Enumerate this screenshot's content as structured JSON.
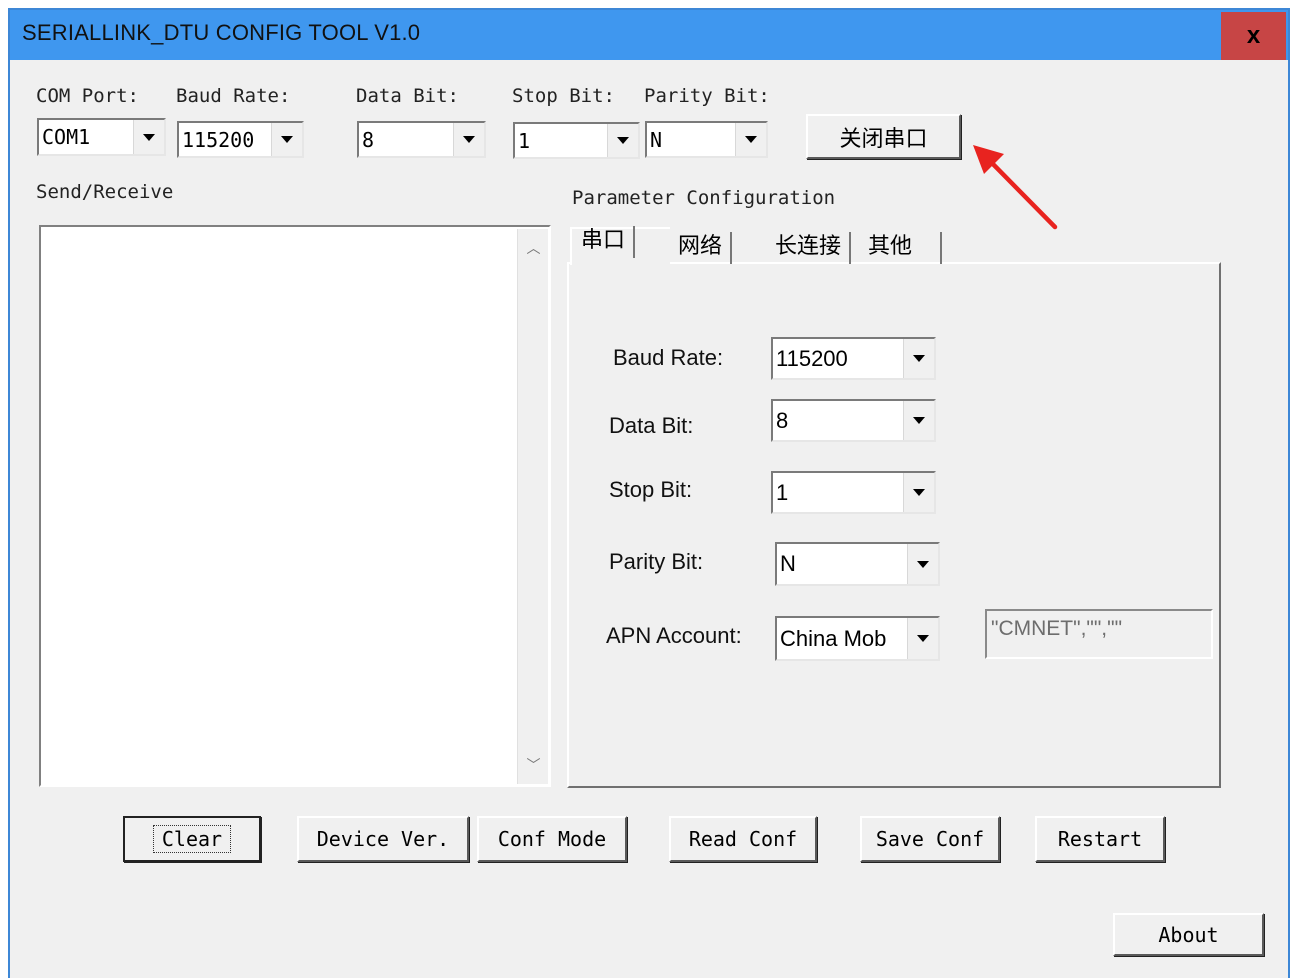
{
  "window": {
    "title": "SERIALLINK_DTU CONFIG TOOL V1.0",
    "close_label": "x"
  },
  "top": {
    "com_port": {
      "label": "COM Port:",
      "value": "COM1"
    },
    "baud_rate": {
      "label": "Baud Rate:",
      "value": "115200"
    },
    "data_bit": {
      "label": "Data Bit:",
      "value": "8"
    },
    "stop_bit": {
      "label": "Stop Bit:",
      "value": "1"
    },
    "parity_bit": {
      "label": "Parity Bit:",
      "value": "N"
    },
    "close_port_button": "关闭串口"
  },
  "send_receive": {
    "label": "Send/Receive",
    "content": ""
  },
  "params": {
    "label": "Parameter Configuration",
    "tabs": [
      "串口",
      "网络",
      "长连接",
      "其他"
    ],
    "baud_rate": {
      "label": "Baud Rate:",
      "value": "115200"
    },
    "data_bit": {
      "label": "Data Bit:",
      "value": "8"
    },
    "stop_bit": {
      "label": "Stop Bit:",
      "value": "1"
    },
    "parity_bit": {
      "label": "Parity Bit:",
      "value": "N"
    },
    "apn": {
      "label": "APN Account:",
      "value": "China Mob",
      "string": "\"CMNET\",\"\",\"\""
    }
  },
  "buttons": {
    "clear": "Clear",
    "device_ver": "Device Ver.",
    "conf_mode": "Conf Mode",
    "read_conf": "Read Conf",
    "save_conf": "Save Conf",
    "restart": "Restart",
    "about": "About"
  },
  "colors": {
    "titlebar": "#3f97ef",
    "close_button": "#c74545",
    "annotation_arrow": "#e8231f"
  },
  "icons": {
    "scroll_up": "chevron-up-icon",
    "scroll_down": "chevron-down-icon",
    "dropdown": "triangle-down-icon",
    "annotation": "red-arrow-icon"
  }
}
